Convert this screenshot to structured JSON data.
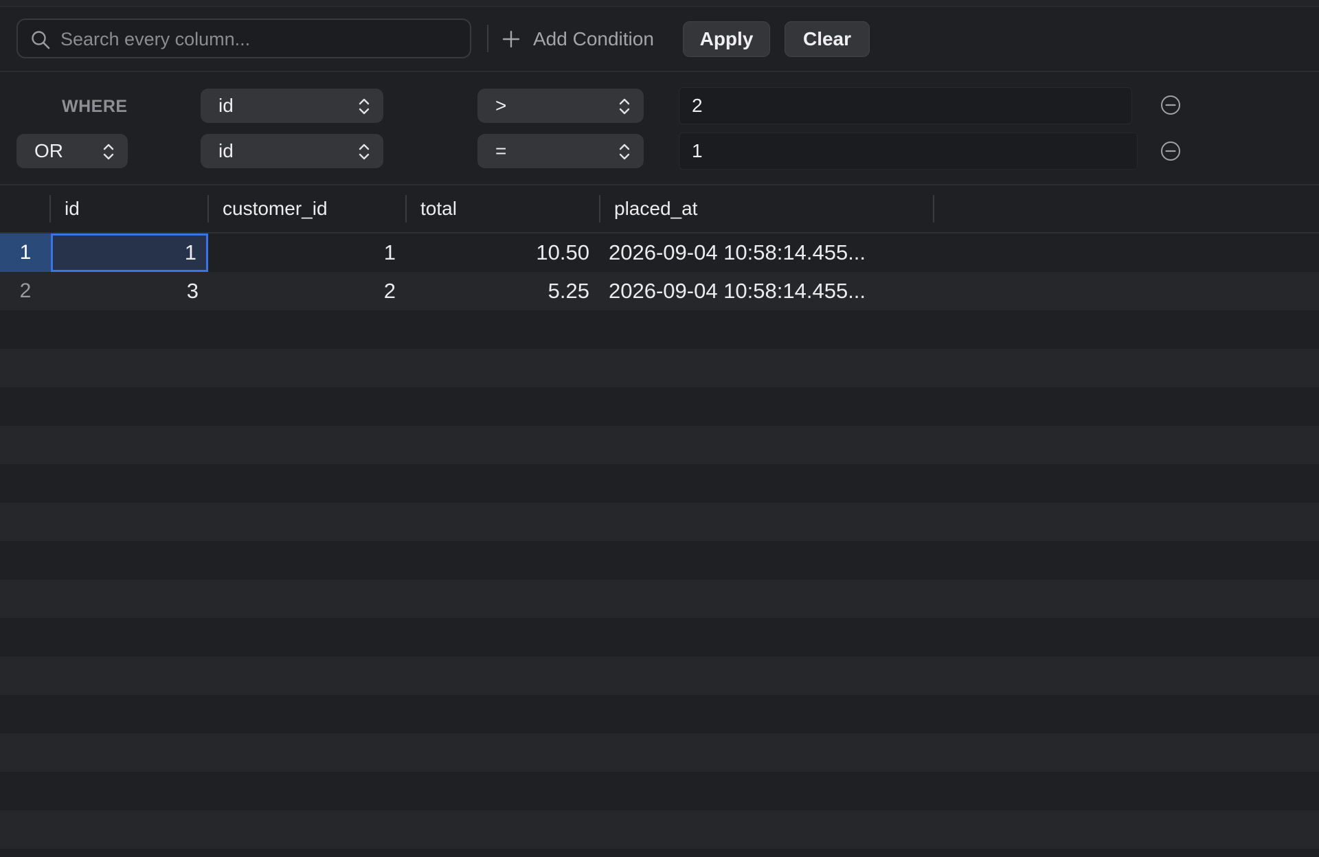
{
  "search": {
    "placeholder": "Search every column..."
  },
  "toolbar": {
    "add_condition_label": "Add Condition",
    "apply_label": "Apply",
    "clear_label": "Clear"
  },
  "conditions": {
    "where_label": "WHERE",
    "rows": [
      {
        "connector": "",
        "column": "id",
        "operator": ">",
        "value": "2"
      },
      {
        "connector": "OR",
        "column": "id",
        "operator": "=",
        "value": "1"
      }
    ]
  },
  "table": {
    "columns": [
      "id",
      "customer_id",
      "total",
      "placed_at"
    ],
    "rows": [
      {
        "row_number": "1",
        "id": "1",
        "customer_id": "1",
        "total": "10.50",
        "placed_at": "2026-09-04 10:58:14.455..."
      },
      {
        "row_number": "2",
        "id": "3",
        "customer_id": "2",
        "total": "5.25",
        "placed_at": "2026-09-04 10:58:14.455..."
      }
    ],
    "selected_row": 0,
    "focused_column": "id"
  },
  "colors": {
    "background": "#1f2023",
    "selection_accent": "#3b74e8",
    "selected_row_number_bg": "#2a4a7a"
  },
  "icons": {
    "search": "search-icon",
    "add": "plus-icon",
    "select_arrows": "chevron-up-down-icon",
    "remove": "minus-circle-icon"
  }
}
